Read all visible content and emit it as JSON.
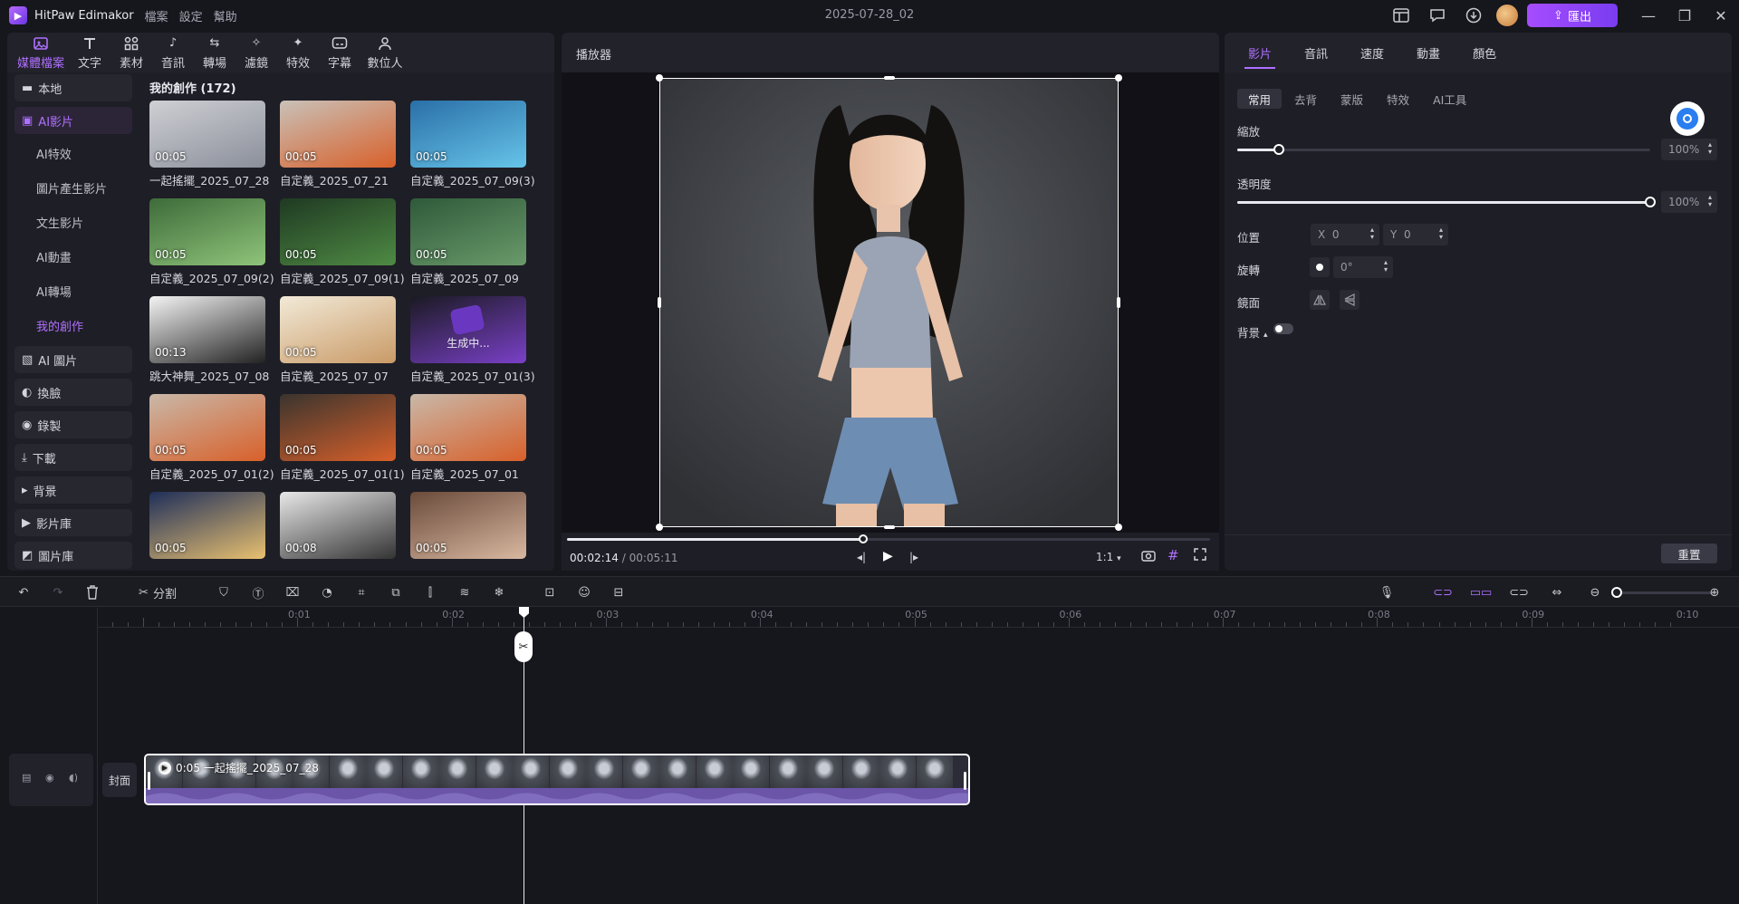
{
  "app": {
    "name": "HitPaw Edimakor",
    "document_title": "2025-07-28_02"
  },
  "menus": [
    "檔案",
    "設定",
    "幫助"
  ],
  "export_label": "匯出",
  "media_tabs": [
    {
      "label": "媒體檔案",
      "icon": "media-files-icon",
      "active": true
    },
    {
      "label": "文字",
      "icon": "text-icon"
    },
    {
      "label": "素材",
      "icon": "assets-icon"
    },
    {
      "label": "音訊",
      "icon": "music-note-icon"
    },
    {
      "label": "轉場",
      "icon": "transition-icon"
    },
    {
      "label": "濾鏡",
      "icon": "filter-icon"
    },
    {
      "label": "特效",
      "icon": "effects-icon"
    },
    {
      "label": "字幕",
      "icon": "subtitle-icon"
    },
    {
      "label": "數位人",
      "icon": "digital-human-icon"
    }
  ],
  "left_nav": {
    "local": "本地",
    "ai_video": "AI影片",
    "ai_sub": [
      "AI特效",
      "圖片產生影片",
      "文生影片",
      "AI動畫",
      "AI轉場",
      "我的創作"
    ],
    "items": [
      "AI 圖片",
      "換臉",
      "錄製",
      "下載",
      "背景",
      "影片庫",
      "圖片庫"
    ]
  },
  "gallery": {
    "heading": "我的創作 (172)",
    "items": [
      {
        "duration": "00:05",
        "name": "一起搖擺_2025_07_28"
      },
      {
        "duration": "00:05",
        "name": "自定義_2025_07_21"
      },
      {
        "duration": "00:05",
        "name": "自定義_2025_07_09(3)"
      },
      {
        "duration": "00:05",
        "name": "自定義_2025_07_09(2)"
      },
      {
        "duration": "00:05",
        "name": "自定義_2025_07_09(1)"
      },
      {
        "duration": "00:05",
        "name": "自定義_2025_07_09"
      },
      {
        "duration": "00:13",
        "name": "跳大神舞_2025_07_08"
      },
      {
        "duration": "00:05",
        "name": "自定義_2025_07_07"
      },
      {
        "duration": "",
        "name": "自定義_2025_07_01(3)",
        "status": "生成中..."
      },
      {
        "duration": "00:05",
        "name": "自定義_2025_07_01(2)"
      },
      {
        "duration": "00:05",
        "name": "自定義_2025_07_01(1)"
      },
      {
        "duration": "00:05",
        "name": "自定義_2025_07_01"
      },
      {
        "duration": "00:05",
        "name": ""
      },
      {
        "duration": "00:08",
        "name": ""
      },
      {
        "duration": "00:05",
        "name": ""
      }
    ]
  },
  "player": {
    "label": "播放器",
    "current_time": "00:02:14",
    "separator": " / ",
    "total_time": "00:05:11",
    "ratio": "1:1",
    "progress": 0.46
  },
  "props": {
    "tabs": [
      "影片",
      "音訊",
      "速度",
      "動畫",
      "顏色"
    ],
    "subtabs": [
      "常用",
      "去背",
      "蒙版",
      "特效",
      "AI工具"
    ],
    "scale_label": "縮放",
    "scale_value": "100%",
    "scale_level": 0.1,
    "opacity_label": "透明度",
    "opacity_value": "100%",
    "opacity_level": 1.0,
    "position_label": "位置",
    "x_label": "X",
    "x_value": "0",
    "y_label": "Y",
    "y_value": "0",
    "rotation_label": "旋轉",
    "rotation_value": "0°",
    "mirror_label": "鏡面",
    "background_label": "背景",
    "reset_label": "重置"
  },
  "timeline": {
    "split_label": "分割",
    "ruler": [
      "0:01",
      "0:02",
      "0:03",
      "0:04",
      "0:05",
      "0:06",
      "0:07",
      "0:08",
      "0:09",
      "0:10"
    ],
    "cover_label": "封面",
    "clip_label": "0:05 一起搖擺_2025_07_28"
  },
  "colors": {
    "accent": "#b070ff",
    "export_gradient_start": "#a64dff",
    "background": "#16161d"
  }
}
